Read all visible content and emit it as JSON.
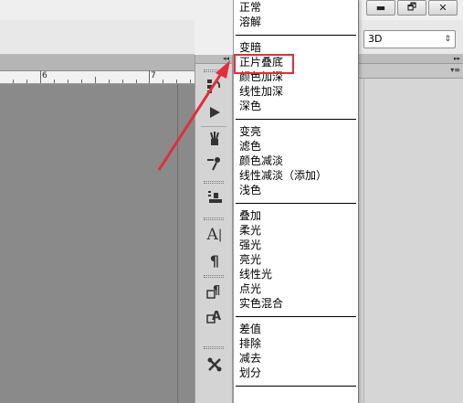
{
  "ruler": {
    "labels": [
      "6",
      "7"
    ]
  },
  "blend_menu": {
    "groups": [
      [
        "正常",
        "溶解"
      ],
      [
        "变暗",
        "正片叠底",
        "颜色加深",
        "线性加深",
        "深色"
      ],
      [
        "变亮",
        "滤色",
        "颜色减淡",
        "线性减淡（添加）",
        "浅色"
      ],
      [
        "叠加",
        "柔光",
        "强光",
        "亮光",
        "线性光",
        "点光",
        "实色混合"
      ],
      [
        "差值",
        "排除",
        "减去",
        "划分"
      ]
    ],
    "highlighted": "正片叠底"
  },
  "workspace_select": {
    "value": "3D"
  },
  "window_controls": {
    "minimize": "▬",
    "restore": "🗗",
    "close": "✕"
  },
  "panel_header_glyph": "◂◂",
  "right_panel_glyphs": {
    "collapse": "▸▸",
    "menu": "▾≡"
  },
  "colors": {
    "annotation": "#e0303a"
  }
}
